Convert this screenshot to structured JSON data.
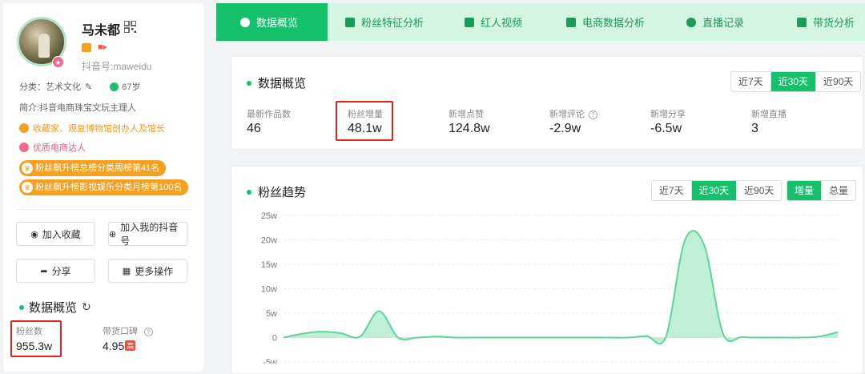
{
  "profile": {
    "name": "马未都",
    "douyin_id": "抖音号:maweidu",
    "category": "分类：艺术文化",
    "age": "67岁",
    "intro": "简介:抖音电商珠宝文玩主理人",
    "honors": [
      "收藏家、观复博物馆创办人及馆长",
      "优质电商达人"
    ],
    "ranks": [
      "粉丝飙升榜总榜分类周榜第41名",
      "粉丝飙升榜影视娱乐分类月榜第100名"
    ],
    "buttons": {
      "favorite": "加入收藏",
      "add_mine": "加入我的抖音号",
      "share": "分享",
      "more": "更多操作"
    },
    "overview_title": "数据概览",
    "fans_label": "粉丝数",
    "fans_value": "955.3w",
    "rep_label": "带货口碑",
    "rep_value": "4.95",
    "rep_badge": "高"
  },
  "tabs": [
    {
      "label": "数据概览",
      "active": true
    },
    {
      "label": "粉丝特征分析"
    },
    {
      "label": "红人视频"
    },
    {
      "label": "电商数据分析"
    },
    {
      "label": "直播记录"
    },
    {
      "label": "带货分析"
    }
  ],
  "overview": {
    "title": "数据概览",
    "ranges": [
      "近7天",
      "近30天",
      "近90天"
    ],
    "metrics": [
      {
        "label": "最新作品数",
        "value": "46"
      },
      {
        "label": "粉丝增量",
        "value": "48.1w"
      },
      {
        "label": "新增点赞",
        "value": "124.8w"
      },
      {
        "label": "新增评论",
        "value": "-2.9w"
      },
      {
        "label": "新增分享",
        "value": "-6.5w"
      },
      {
        "label": "新增直播",
        "value": "3"
      }
    ]
  },
  "trend": {
    "title": "粉丝趋势",
    "ranges": [
      "近7天",
      "近30天",
      "近90天"
    ],
    "modes": [
      "增量",
      "总量"
    ]
  },
  "chart_data": {
    "type": "area",
    "ylim": [
      -5,
      25
    ],
    "yticks": [
      "-5w",
      "0",
      "5w",
      "10w",
      "15w",
      "20w",
      "25w"
    ],
    "ytick_values": [
      -5,
      0,
      5,
      10,
      15,
      20,
      25
    ],
    "color": "#5ed49a",
    "fill": "#b5ecd0",
    "x": [
      0,
      1,
      2,
      3,
      4,
      5,
      6,
      7,
      8,
      9,
      10,
      11,
      12,
      13,
      14,
      15,
      16,
      17,
      18,
      19,
      20,
      21,
      22,
      23,
      24,
      25,
      26,
      27,
      28,
      29
    ],
    "values": [
      0,
      0.8,
      1.2,
      0.9,
      0.2,
      5.4,
      0,
      0,
      0.2,
      0,
      0,
      0,
      0,
      0,
      0,
      0,
      0,
      0,
      0,
      0.3,
      0.1,
      19.9,
      19.0,
      0.8,
      0.1,
      0,
      0,
      0,
      0.2,
      1.1
    ]
  }
}
